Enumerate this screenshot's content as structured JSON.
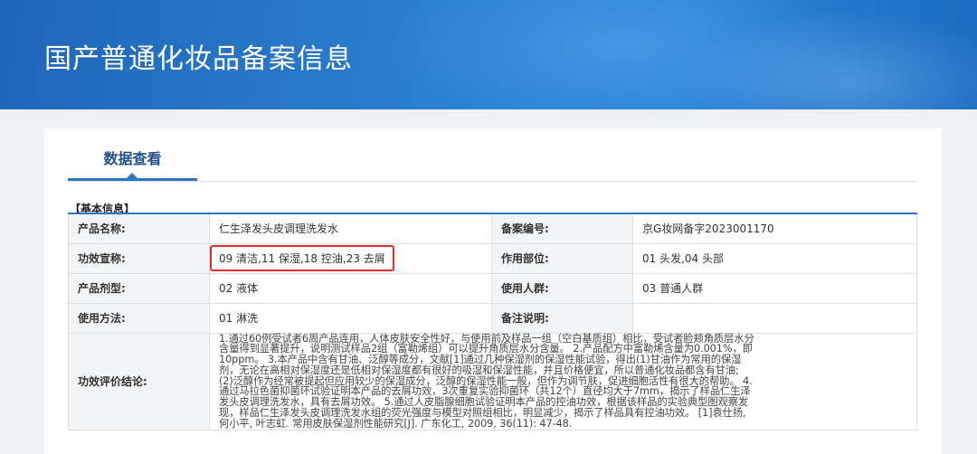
{
  "banner": {
    "title": "国产普通化妆品备案信息"
  },
  "tabs": [
    {
      "label": "数据查看"
    }
  ],
  "section": {
    "title": "【基本信息】"
  },
  "rows": [
    {
      "label1": "产品名称:",
      "value1": "仁生泽发头皮调理洗发水",
      "label2": "备案编号:",
      "value2": "京G妆网备字2023001170"
    },
    {
      "label1": "功效宣称:",
      "value1": "09 清洁,11 保湿,18 控油,23 去屑",
      "label2": "作用部位:",
      "value2": "01 头发,04 头部"
    },
    {
      "label1": "产品剂型:",
      "value1": "02 液体",
      "label2": "使用人群:",
      "value2": "03 普通人群"
    },
    {
      "label1": "使用方法:",
      "value1": "01 淋洗",
      "label2": "备注说明:",
      "value2": ""
    }
  ],
  "conclusion": {
    "label": "功效评价结论:",
    "lines": [
      "1.通过60例受试者6周产品连用，人体皮肤安全性好，与使用前及样品一组（空白基质组）相比，受试者脸颊角质层水分",
      "含量得到显著提升，说明测试样品2组（富勒烯组）可以提升角质层水分含量。 2.产品配方中富勒烯含量为0.001%，即",
      "10ppm。 3.本产品中含有甘油、泛醇等成分，文献[1]通过几种保湿剂的保湿性能试验，得出(1)甘油作为常用的保湿",
      "剂，无论在高相对保湿度还是低相对保湿度都有很好的吸湿和保湿性能，并且价格便宜，所以普通化妆品都含有甘油;",
      "(2)泛醇作为经常被提起但应用较少的保湿成分，泛醇的保湿性能一般，但作为调节肤，促进细胞活性有很大的帮助。 4.",
      "通过马拉色菌抑菌环试验证明本产品的去屑功效，3次重复实验抑菌环（共12个）直径均大于7mm，揭示了样品仁生泽",
      "发头皮调理洗发水，具有去屑功效。 5.通过人皮脂腺细胞试验证明本产品的控油功效，根据该样品的实验典型图观察发",
      "现，样品仁生泽发头皮调理洗发水组的荧光强度与模型对照组相比，明显减少，揭示了样品具有控油功效。 [1]袁仕扬,",
      "何小平, 叶志虹. 常用皮肤保湿剂性能研究[J]. 广东化工, 2009, 36(11): 47-48."
    ]
  }
}
